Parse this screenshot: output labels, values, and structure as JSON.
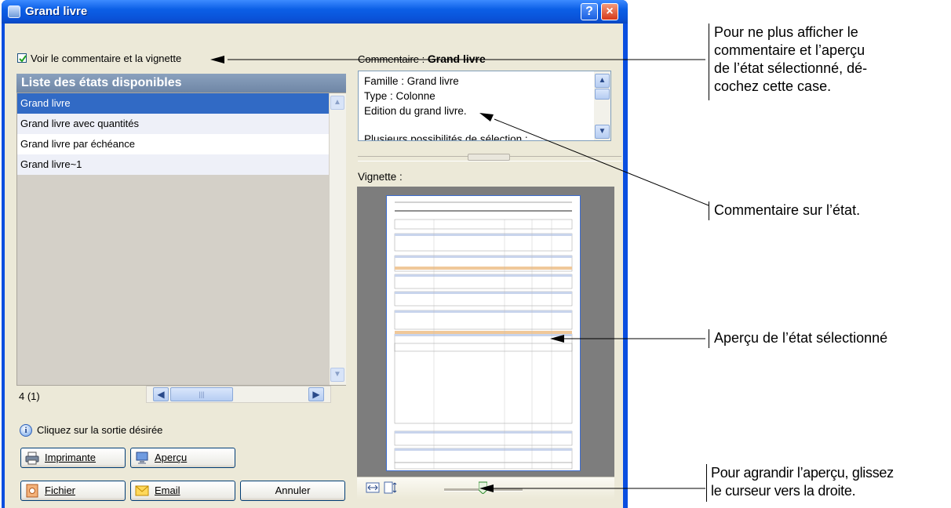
{
  "window": {
    "title": "Grand livre",
    "help_button": "?",
    "close_button": "×"
  },
  "options": {
    "show_comment_label": "Voir le commentaire et la vignette",
    "show_comment_checked": true
  },
  "list": {
    "header": "Liste des états disponibles",
    "items": [
      {
        "label": "Grand livre",
        "selected": true
      },
      {
        "label": "Grand livre avec quantités",
        "selected": false
      },
      {
        "label": "Grand livre par échéance",
        "selected": false
      },
      {
        "label": "Grand livre~1",
        "selected": false
      }
    ],
    "count": "4 (1)"
  },
  "hint": {
    "text": "Cliquez sur la sortie désirée"
  },
  "buttons": {
    "printer": "Imprimante",
    "preview": "Aperçu",
    "file": "Fichier",
    "email": "Email",
    "cancel": "Annuler"
  },
  "comment": {
    "label": "Commentaire : ",
    "title": "Grand livre",
    "lines": [
      "Famille : Grand livre",
      "Type : Colonne",
      "Edition du grand livre.",
      "Plusieurs possibilités de sélection :"
    ]
  },
  "thumbnail": {
    "label": "Vignette :"
  },
  "annotations": {
    "checkbox_note": [
      "Pour ne plus afficher le",
      "commentaire et l’aperçu",
      "de l’état sélectionné, dé-",
      "cochez cette case."
    ],
    "comment_note": "Commentaire sur l’état.",
    "preview_note": "Aperçu de l’état sélectionné",
    "slider_note": [
      "Pour agrandir l’aperçu, glissez",
      "le curseur vers la droite."
    ]
  },
  "colors": {
    "title_bar": "#0a52d8",
    "selection": "#316ac5",
    "list_header": "#7a90ae",
    "preview_background": "#7d7d7d"
  }
}
